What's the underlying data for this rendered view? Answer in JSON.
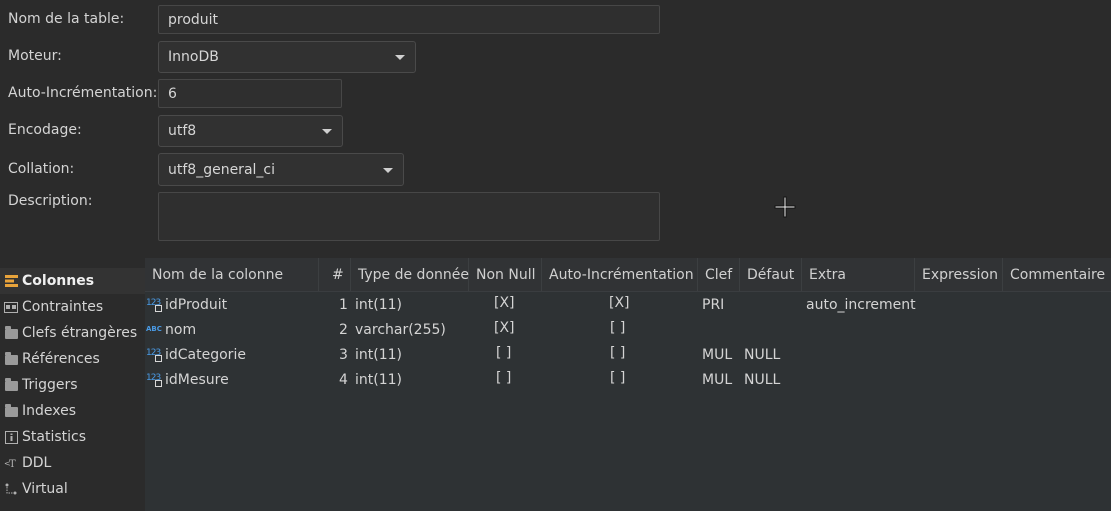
{
  "form": {
    "table_name_label": "Nom de la table:",
    "table_name_value": "produit",
    "engine_label": "Moteur:",
    "engine_value": "InnoDB",
    "auto_increment_label": "Auto-Incrémentation:",
    "auto_increment_value": "6",
    "encoding_label": "Encodage:",
    "encoding_value": "utf8",
    "collation_label": "Collation:",
    "collation_value": "utf8_general_ci",
    "description_label": "Description:",
    "description_value": ""
  },
  "tabs": [
    {
      "label": "Colonnes",
      "icon": "columns-icon",
      "active": true
    },
    {
      "label": "Contraintes",
      "icon": "constraints-icon"
    },
    {
      "label": "Clefs étrangères",
      "icon": "folder-icon"
    },
    {
      "label": "Références",
      "icon": "folder-icon"
    },
    {
      "label": "Triggers",
      "icon": "folder-icon"
    },
    {
      "label": "Indexes",
      "icon": "folder-icon"
    },
    {
      "label": "Statistics",
      "icon": "info-icon"
    },
    {
      "label": "DDL",
      "icon": "ddl-icon"
    },
    {
      "label": "Virtual",
      "icon": "virtual-icon"
    }
  ],
  "grid": {
    "headers": [
      "Nom de la colonne",
      "#",
      "Type de donnée",
      "Non Null",
      "Auto-Incrémentation",
      "Clef",
      "Défaut",
      "Extra",
      "Expression",
      "Commentaire"
    ],
    "rows": [
      {
        "type_icon": "numeric-key-icon",
        "name": "idProduit",
        "num": "1",
        "type": "int(11)",
        "not_null": "[X]",
        "auto_inc": "[X]",
        "key": "PRI",
        "default": "",
        "extra": "auto_increment"
      },
      {
        "type_icon": "text-icon",
        "name": "nom",
        "num": "2",
        "type": "varchar(255)",
        "not_null": "[X]",
        "auto_inc": "[ ]",
        "key": "",
        "default": "",
        "extra": ""
      },
      {
        "type_icon": "numeric-key-icon",
        "name": "idCategorie",
        "num": "3",
        "type": "int(11)",
        "not_null": "[ ]",
        "auto_inc": "[ ]",
        "key": "MUL",
        "default": "NULL",
        "extra": ""
      },
      {
        "type_icon": "numeric-key-icon",
        "name": "idMesure",
        "num": "4",
        "type": "int(11)",
        "not_null": "[ ]",
        "auto_inc": "[ ]",
        "key": "MUL",
        "default": "NULL",
        "extra": ""
      }
    ]
  },
  "colors": {
    "background": "#2b2b2b",
    "grid_background": "#2e3234",
    "accent_icon": "#4a9be6",
    "splitter_arrow": "#6b6bc9"
  }
}
